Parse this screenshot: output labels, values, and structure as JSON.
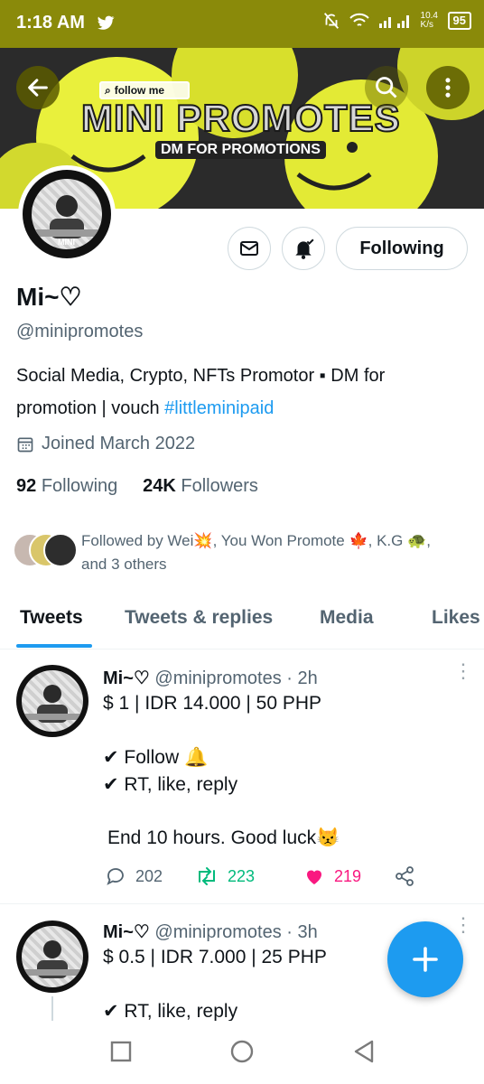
{
  "status_bar": {
    "time": "1:18 AM",
    "net_speed": "10.4\nK/s",
    "battery": "95"
  },
  "banner": {
    "follow_tag": "follow me",
    "title": "MINI PROMOTES",
    "subtitle": "DM FOR PROMOTIONS"
  },
  "profile": {
    "avatar_text": "MINI",
    "name": "Mi~♡",
    "handle": "@minipromotes",
    "bio_prefix": "Social Media, Crypto, NFTs Promotor ▪ DM for promotion | vouch ",
    "bio_hashtag": "#littleminipaid",
    "joined": "Joined March 2022",
    "following_count": "92",
    "following_label": "Following",
    "followers_count": "24K",
    "followers_label": "Followers",
    "followed_by": "Followed by Wei💥, You Won Promote 🍁, K.G 🐢, and 3 others",
    "following_button": "Following"
  },
  "tabs": [
    "Tweets",
    "Tweets & replies",
    "Media",
    "Likes"
  ],
  "tweets": [
    {
      "name": "Mi~♡",
      "meta": "@minipromotes · 2h",
      "line1": "$ 1 | IDR 14.000 | 50 PHP",
      "line2": "✔ Follow 🔔",
      "line3": "✔ RT, like, reply",
      "line4": "End 10 hours. Good luck😾",
      "replies": "202",
      "retweets": "223",
      "likes": "219"
    },
    {
      "name": "Mi~♡",
      "meta": "@minipromotes · 3h",
      "line1": "$ 0.5 | IDR 7.000 | 25 PHP",
      "line3": "✔ RT, like, reply"
    }
  ],
  "colors": {
    "accent": "#1d9bf0",
    "status_bar": "#8a8a0a",
    "retweet": "#00ba7c",
    "like": "#f91880"
  }
}
